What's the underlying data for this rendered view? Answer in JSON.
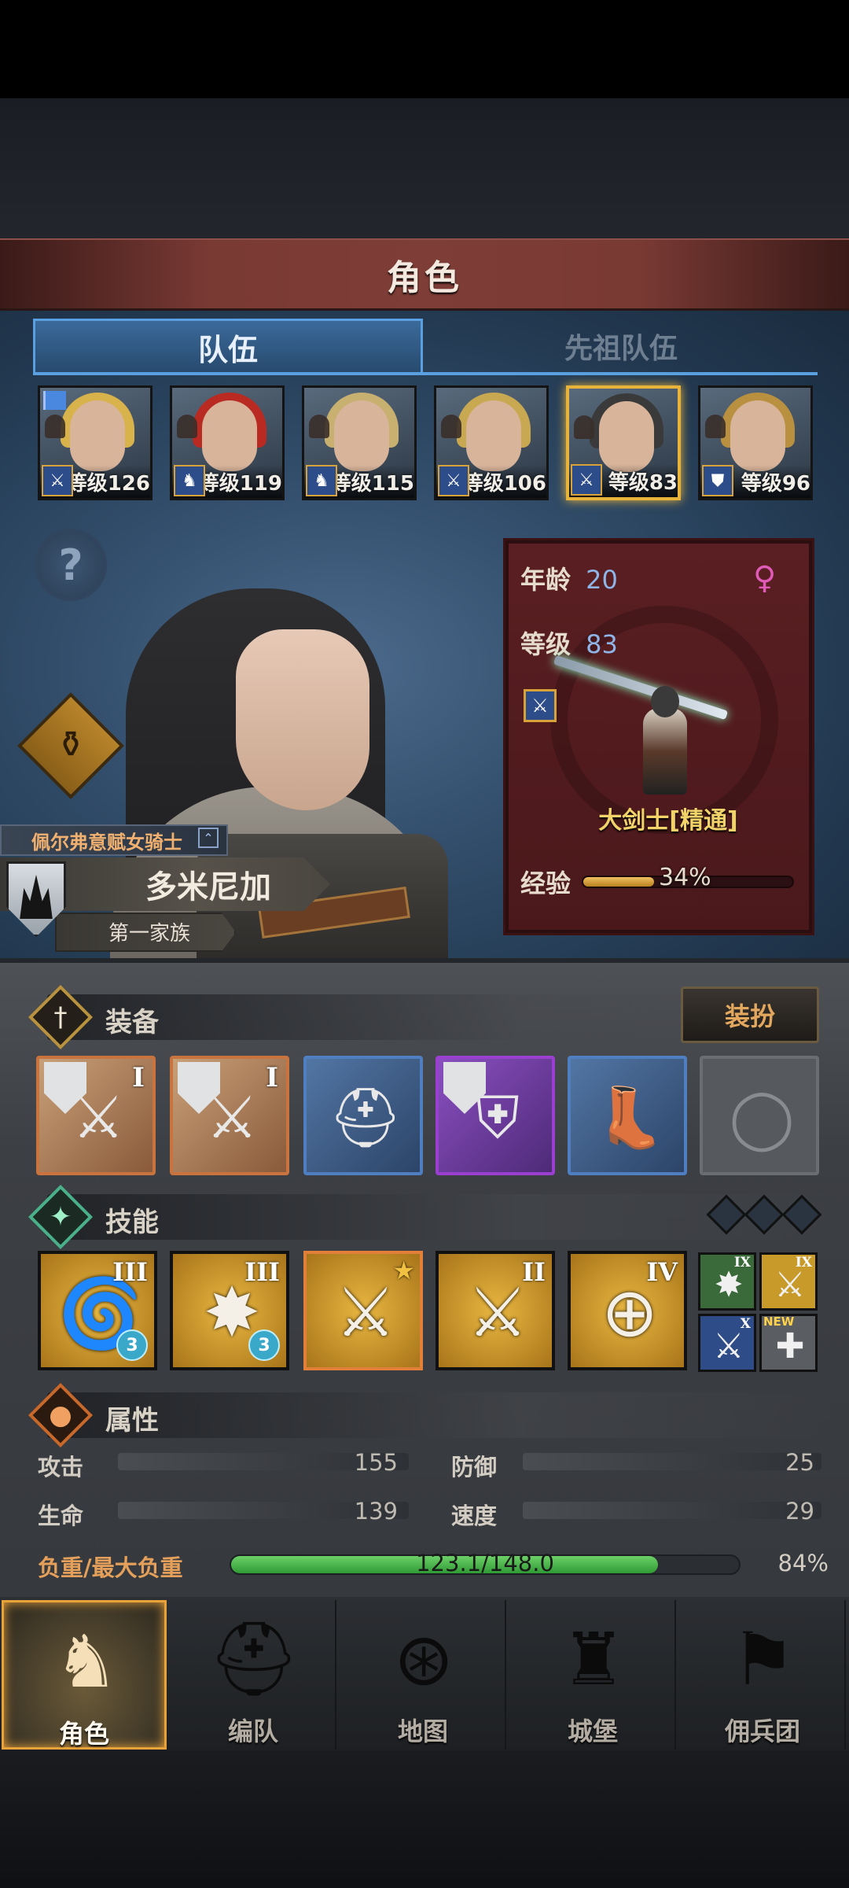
{
  "header": {
    "title": "角色"
  },
  "tabs": [
    {
      "label": "队伍",
      "active": true
    },
    {
      "label": "先祖队伍",
      "active": false
    }
  ],
  "roster": [
    {
      "level_text": "等级126",
      "class_icon": "sword-icon",
      "hair": "#d8b24a",
      "flag": true
    },
    {
      "level_text": "等级119",
      "class_icon": "horse-icon",
      "hair": "#b82a22",
      "flag": false
    },
    {
      "level_text": "等级115",
      "class_icon": "horse-icon",
      "hair": "#c8b070",
      "flag": false
    },
    {
      "level_text": "等级106",
      "class_icon": "sword-icon",
      "hair": "#c8a850",
      "flag": false
    },
    {
      "level_text": "等级83",
      "class_icon": "sword-icon",
      "hair": "#3a3a3a",
      "flag": false,
      "selected": true
    },
    {
      "level_text": "等级96",
      "class_icon": "shield-icon",
      "hair": "#b89040",
      "flag": false
    }
  ],
  "hero": {
    "title": "佩尔弗意赋女骑士",
    "name": "多米尼加",
    "family": "第一家族"
  },
  "info_card": {
    "age_label": "年龄",
    "age": "20",
    "level_label": "等级",
    "level": "83",
    "gender_icon": "female-icon",
    "class_name": "大剑士[精通]",
    "exp_label": "经验",
    "exp_percent": "34%",
    "exp_fraction": 0.34
  },
  "equipment": {
    "title": "装备",
    "dress_button": "装扮",
    "slots": [
      {
        "rarity": "orange",
        "tier": "I",
        "icon": "greatsword-icon",
        "shield": true
      },
      {
        "rarity": "orange",
        "tier": "I",
        "icon": "greatsword-icon",
        "shield": true
      },
      {
        "rarity": "blue",
        "tier": "",
        "icon": "helmet-icon",
        "shield": false
      },
      {
        "rarity": "purple",
        "tier": "",
        "icon": "armor-icon",
        "shield": true
      },
      {
        "rarity": "blue",
        "tier": "",
        "icon": "boots-icon",
        "shield": false
      },
      {
        "rarity": "empty",
        "tier": "",
        "icon": "ring-icon",
        "shield": false
      }
    ]
  },
  "skills": {
    "title": "技能",
    "items": [
      {
        "tier": "III",
        "icon": "whirlwind-icon",
        "badge": "3"
      },
      {
        "tier": "III",
        "icon": "burst-strike-icon",
        "badge": "3"
      },
      {
        "tier": "",
        "icon": "sword-stance-icon",
        "star": true
      },
      {
        "tier": "II",
        "icon": "sword-stance-icon"
      },
      {
        "tier": "IV",
        "icon": "target-strike-icon"
      }
    ],
    "mini": [
      {
        "tier": "IX",
        "icon": "burst-icon",
        "bg": "#3b6a3a"
      },
      {
        "tier": "IX",
        "icon": "sword-icon",
        "bg": "#c89a2a"
      },
      {
        "tier": "X",
        "icon": "sword-icon",
        "bg": "#2e4c88"
      },
      {
        "tier": "",
        "icon": "cross-icon",
        "bg": "#5a5d62",
        "new": "NEW"
      }
    ]
  },
  "attributes": {
    "title": "属性",
    "attack_label": "攻击",
    "attack": "155",
    "defense_label": "防御",
    "defense": "25",
    "hp_label": "生命",
    "hp": "139",
    "speed_label": "速度",
    "speed": "29",
    "load_label": "负重/最大负重",
    "load_value": "123.1/148.0",
    "load_percent": "84%",
    "load_fraction": 0.84
  },
  "nav": [
    {
      "label": "角色",
      "icon": "knight-icon",
      "active": true
    },
    {
      "label": "编队",
      "icon": "helmet-icon",
      "active": false
    },
    {
      "label": "地图",
      "icon": "compass-map-icon",
      "active": false
    },
    {
      "label": "城堡",
      "icon": "castle-icon",
      "active": false
    },
    {
      "label": "佣兵团",
      "icon": "banner-icon",
      "active": false
    }
  ]
}
